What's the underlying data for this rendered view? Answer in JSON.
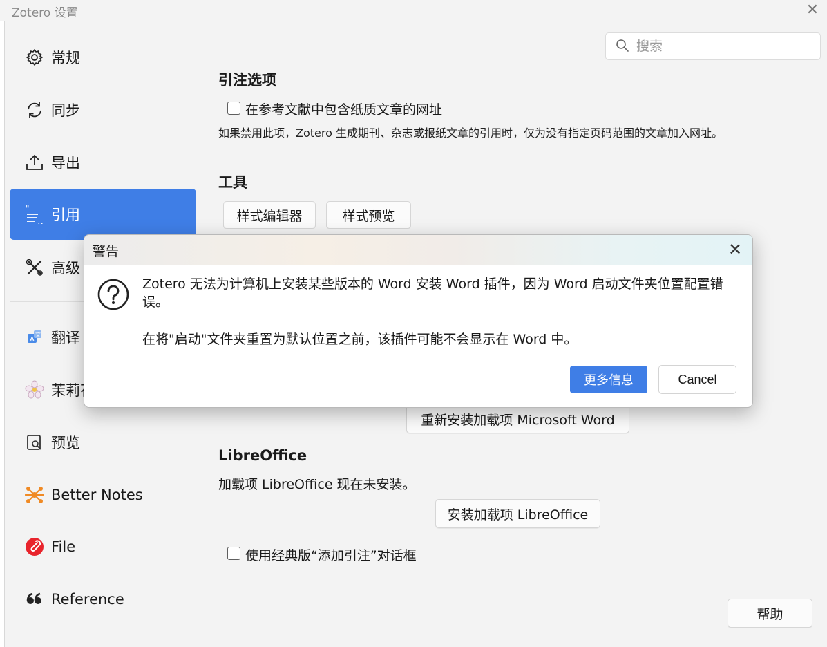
{
  "window": {
    "title": "Zotero 设置",
    "close_symbol": "✕"
  },
  "search": {
    "placeholder": "搜索"
  },
  "sidebar": {
    "items": [
      {
        "label": "常规",
        "icon": "gear-icon"
      },
      {
        "label": "同步",
        "icon": "sync-icon"
      },
      {
        "label": "导出",
        "icon": "export-icon"
      },
      {
        "label": "引用",
        "icon": "cite-icon",
        "active": true
      },
      {
        "label": "高级",
        "icon": "tools-icon"
      },
      {
        "label": "翻译",
        "icon": "translate-icon"
      },
      {
        "label": "茉莉花",
        "icon": "jasmine-icon"
      },
      {
        "label": "预览",
        "icon": "preview-icon"
      },
      {
        "label": "Better Notes",
        "icon": "better-notes-icon"
      },
      {
        "label": "File",
        "icon": "file-icon"
      },
      {
        "label": "Reference",
        "icon": "quote-icon"
      }
    ]
  },
  "main": {
    "cite_options_title": "引注选项",
    "include_urls_label": "在参考文献中包含纸质文章的网址",
    "include_urls_desc": "如果禁用此项，Zotero 生成期刊、杂志或报纸文章的引用时，仅为没有指定页码范围的文章加入网址。",
    "tools_title": "工具",
    "style_editor_button": "样式编辑器",
    "style_preview_button": "样式预览",
    "reinstall_word_button": "重新安装加载项 Microsoft Word",
    "libreoffice_title": "LibreOffice",
    "libreoffice_status": "加载项 LibreOffice 现在未安装。",
    "install_libreoffice_button": "安装加载项 LibreOffice",
    "classic_dialog_label": "使用经典版“添加引注”对话框",
    "help_button": "帮助"
  },
  "dialog": {
    "title": "警告",
    "message": "Zotero 无法为计算机上安装某些版本的 Word 安装 Word 插件，因为 Word 启动文件夹位置配置错误。",
    "message2": "在将\"启动\"文件夹重置为默认位置之前，该插件可能不会显示在 Word 中。",
    "primary_button": "更多信息",
    "cancel_button": "Cancel",
    "close_symbol": "✕"
  },
  "colors": {
    "accent": "#3f7ee6"
  }
}
